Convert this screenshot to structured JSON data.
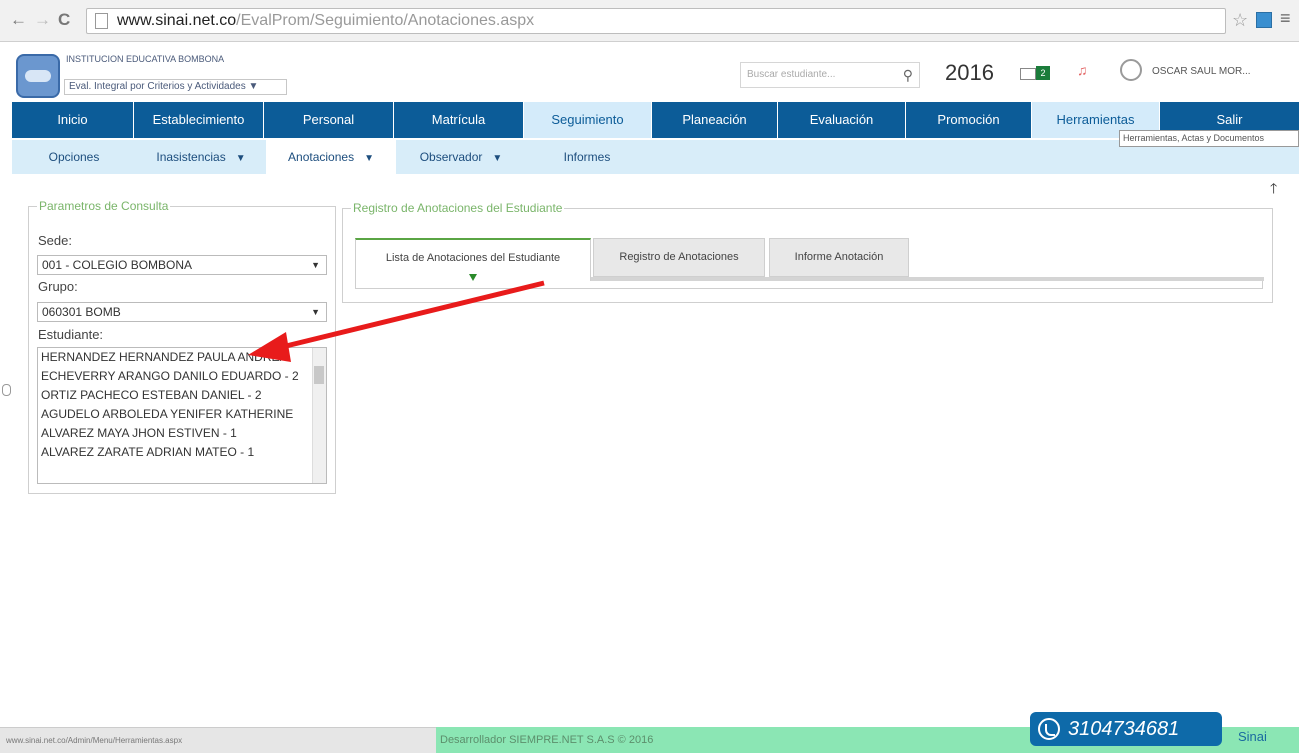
{
  "browser": {
    "back": "←",
    "forward": "→",
    "reload": "C",
    "url_host": "www.sinai.net.co",
    "url_path": "/EvalProm/Seguimiento/Anotaciones.aspx",
    "star": "☆",
    "menu": "≡"
  },
  "header": {
    "institution": "INSTITUCION EDUCATIVA BOMBONA",
    "mode": "Eval. Integral por Criterios y Actividades ▼",
    "search_placeholder": "Buscar estudiante...",
    "search_icon": "⚲",
    "year": "2016",
    "mail_count": "2",
    "bell": "♫",
    "user": "OSCAR SAUL MOR..."
  },
  "mainnav": [
    {
      "label": "Inicio"
    },
    {
      "label": "Establecimiento"
    },
    {
      "label": "Personal"
    },
    {
      "label": "Matrícula"
    },
    {
      "label": "Seguimiento"
    },
    {
      "label": "Planeación"
    },
    {
      "label": "Evaluación"
    },
    {
      "label": "Promoción"
    },
    {
      "label": "Herramientas"
    },
    {
      "label": "Salir"
    }
  ],
  "tooltip": "Herramientas, Actas y Documentos",
  "subnav": [
    {
      "label": "Opciones",
      "caret": ""
    },
    {
      "label": "Inasistencias",
      "caret": "▼"
    },
    {
      "label": "Anotaciones",
      "caret": "▼"
    },
    {
      "label": "Observador",
      "caret": "▼"
    },
    {
      "label": "Informes",
      "caret": ""
    }
  ],
  "scroll_top": "🡑",
  "params": {
    "legend": "Parametros de Consulta",
    "sede_label": "Sede:",
    "sede_value": "001 - COLEGIO BOMBONA",
    "grupo_label": "Grupo:",
    "grupo_value": "060301 BOMB",
    "estudiante_label": "Estudiante:",
    "students": [
      "HERNANDEZ HERNANDEZ PAULA ANDREA",
      "ECHEVERRY ARANGO DANILO EDUARDO - 2",
      "ORTIZ PACHECO ESTEBAN DANIEL - 2",
      "AGUDELO ARBOLEDA YENIFER KATHERINE",
      "ALVAREZ MAYA JHON ESTIVEN - 1",
      "ALVAREZ ZARATE ADRIAN MATEO - 1"
    ],
    "dropdown_caret": "▼"
  },
  "registro": {
    "legend": "Registro de Anotaciones del Estudiante",
    "tabs": [
      {
        "label": "Lista de Anotaciones del Estudiante"
      },
      {
        "label": "Registro de Anotaciones"
      },
      {
        "label": "Informe Anotación"
      }
    ]
  },
  "footer": {
    "status_url": "www.sinai.net.co/Admin/Menu/Herramientas.aspx",
    "developer": "Desarrollador SIEMPRE.NET S.A.S © 2016",
    "phone": "3104734681",
    "brand": "Sinai"
  },
  "colors": {
    "nav_blue": "#0c5c98",
    "subnav_blue": "#d8edf9",
    "legend_green": "#7ab56a",
    "footer_green": "#8be6b4",
    "arrow_red": "#e81b1b"
  }
}
